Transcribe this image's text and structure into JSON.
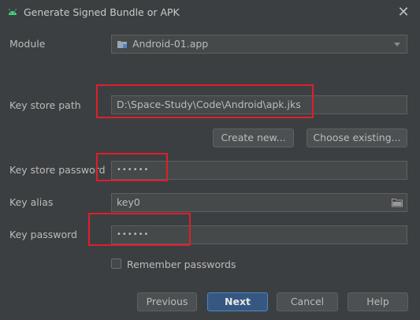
{
  "window": {
    "title": "Generate Signed Bundle or APK",
    "app_icon": "android-icon",
    "close_glyph": "✕"
  },
  "module": {
    "label": "Module",
    "value": "Android-01.app",
    "icon": "module-folder-icon"
  },
  "key_store_path": {
    "label": "Key store path",
    "value": "D:\\Space-Study\\Code\\Android\\apk.jks"
  },
  "buttons": {
    "create_new": "Create new...",
    "choose_existing": "Choose existing..."
  },
  "key_store_password": {
    "label": "Key store password",
    "masked_value": "••••••"
  },
  "key_alias": {
    "label": "Key alias",
    "value": "key0",
    "icon": "folder-icon"
  },
  "key_password": {
    "label": "Key password",
    "masked_value": "••••••"
  },
  "remember": {
    "label": "Remember passwords",
    "checked": false
  },
  "footer": {
    "previous": "Previous",
    "next": "Next",
    "cancel": "Cancel",
    "help": "Help"
  },
  "colors": {
    "background": "#3c3f41",
    "field": "#45494a",
    "primary_button": "#365880",
    "highlight_box": "#e01e2a"
  }
}
